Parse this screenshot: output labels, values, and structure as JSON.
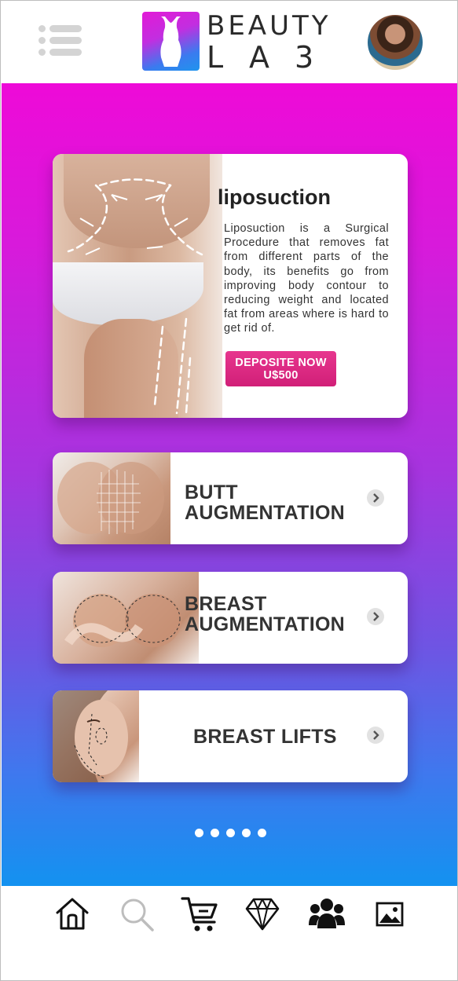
{
  "header": {
    "brand_line1": "BEAUTY",
    "brand_line2": "LA3",
    "menu_icon": "list-menu-icon",
    "avatar": "user-avatar"
  },
  "hero": {
    "title": "liposuction",
    "description": "Liposuction is a Surgical Procedure that removes fat from different parts  of the body, its benefits go from improving body contour to reducing weight and located fat from areas where is hard to get rid of.",
    "button_line1": "DEPOSITE NOW",
    "button_line2": "U$500"
  },
  "services": [
    {
      "line1": "BUTT",
      "line2": "AUGMENTATION",
      "icon": "chevron-right-icon"
    },
    {
      "line1": "BREAST",
      "line2": "AUGMENTATION",
      "icon": "chevron-right-icon"
    },
    {
      "line1": "BREAST LIFTS",
      "icon": "chevron-right-icon"
    }
  ],
  "pagination": {
    "count": 5
  },
  "bottom_nav": [
    {
      "name": "home",
      "icon": "home-icon"
    },
    {
      "name": "search",
      "icon": "search-icon"
    },
    {
      "name": "cart",
      "icon": "cart-icon"
    },
    {
      "name": "diamond",
      "icon": "diamond-icon"
    },
    {
      "name": "group",
      "icon": "group-icon"
    },
    {
      "name": "gallery",
      "icon": "image-icon"
    }
  ],
  "colors": {
    "gradient_top": "#ee0ad8",
    "gradient_bottom": "#1392f0",
    "button": "#d11f78",
    "text_dark": "#333333"
  }
}
